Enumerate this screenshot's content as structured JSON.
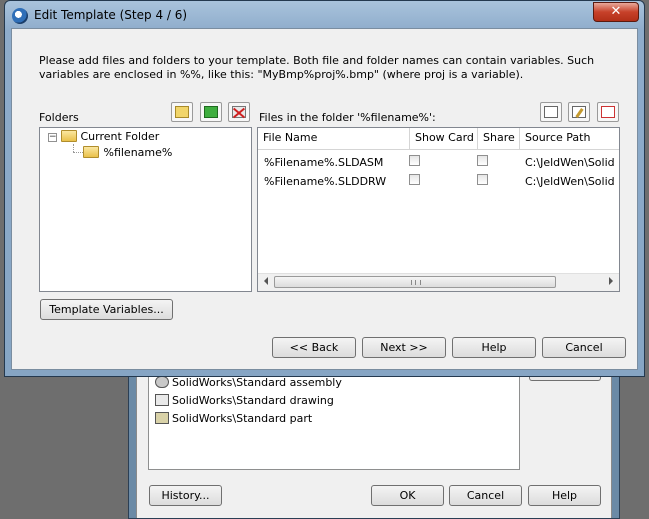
{
  "background_dialog": {
    "list_items": [
      {
        "label": "SolidWorks\\Standard assembly",
        "icon": "assembly-icon"
      },
      {
        "label": "SolidWorks\\Standard drawing",
        "icon": "drawing-icon"
      },
      {
        "label": "SolidWorks\\Standard part",
        "icon": "part-icon"
      }
    ],
    "history_label": "History...",
    "ok_label": "OK",
    "cancel_label": "Cancel",
    "help_label": "Help"
  },
  "dialog": {
    "title": "Edit Template (Step 4 / 6)",
    "close_glyph": "✕",
    "instructions": "Please add files and folders to your template. Both file and folder names can contain variables. Such variables are enclosed in %%, like this: \"MyBmp%proj%.bmp\" (where proj is a variable).",
    "folders_label": "Folders",
    "files_label": "Files in the folder '%filename%':",
    "tree": {
      "root": {
        "label": "Current Folder",
        "expander": "−"
      },
      "child": {
        "label": "%filename%"
      }
    },
    "files_table": {
      "headers": [
        "File Name",
        "Show Card",
        "Share",
        "Source Path"
      ],
      "rows": [
        {
          "file_name": "%Filename%.SLDASM",
          "source_path": "C:\\JeldWen\\Solid"
        },
        {
          "file_name": "%Filename%.SLDDRW",
          "source_path": "C:\\JeldWen\\Solid"
        }
      ]
    },
    "template_variables_label": "Template Variables...",
    "back_label": "<< Back",
    "next_label": "Next >>",
    "help_label": "Help",
    "cancel_label": "Cancel"
  },
  "colors": {
    "title_bar": "#8eaccb",
    "close_button": "#c7412a",
    "window_face": "#f0f0f0",
    "folder_icon": "#e9c14b"
  }
}
